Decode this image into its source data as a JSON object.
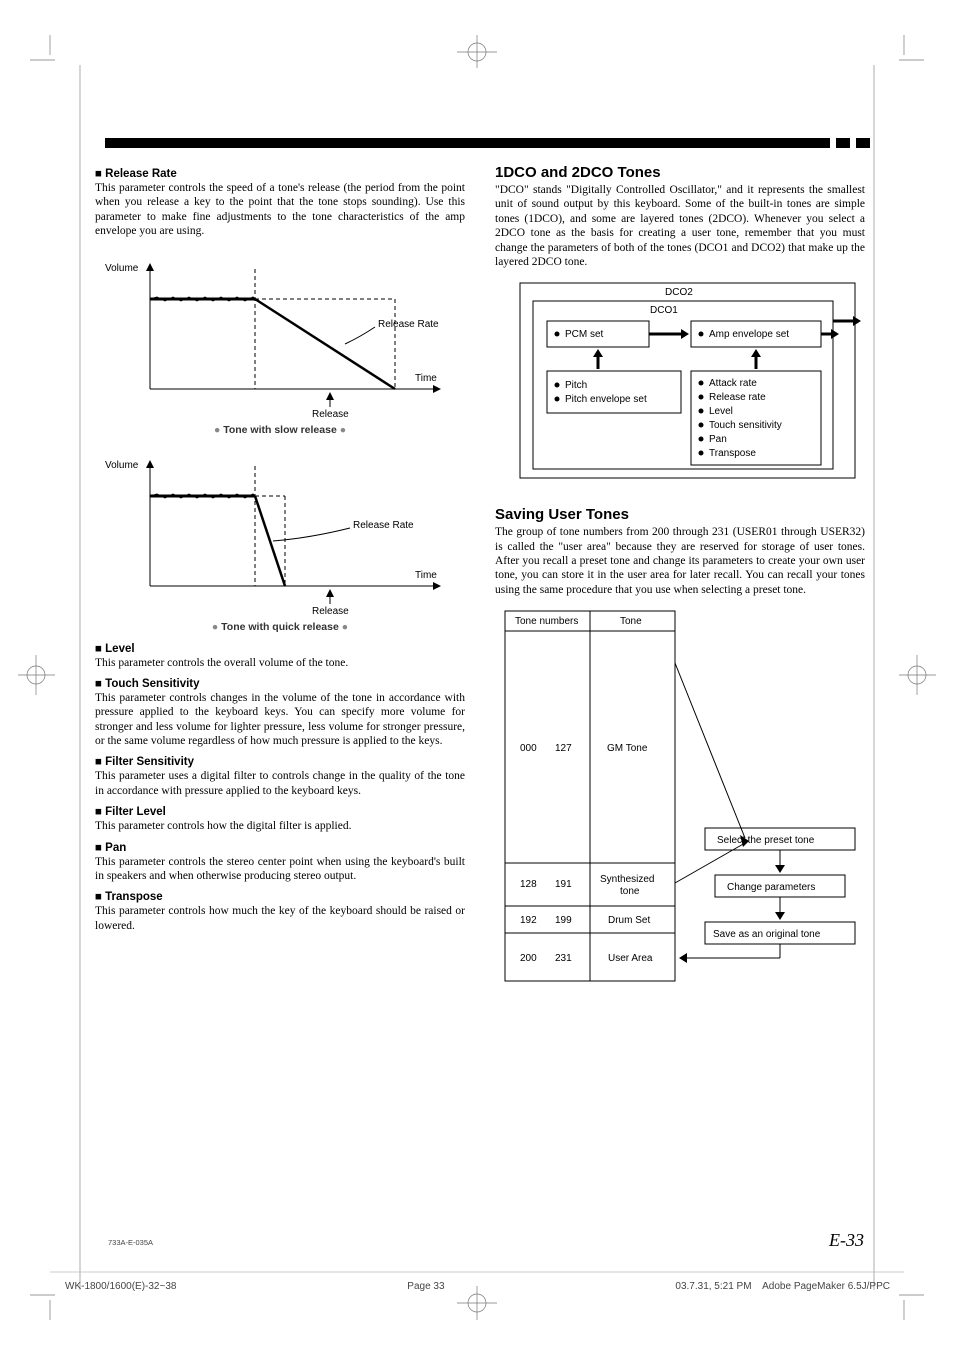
{
  "left": {
    "release_rate_h": "Release Rate",
    "release_rate_p": "This parameter controls the speed of a tone's release (the period from the point when you release a key to the point that the tone stops sounding). Use this parameter to make fine adjustments to the tone characteristics of the amp envelope you are using.",
    "graph1": {
      "ylabel": "Volume",
      "release_rate": "Release Rate",
      "release": "Release",
      "time": "Time",
      "caption": "Tone with slow release"
    },
    "graph2": {
      "ylabel": "Volume",
      "release_rate": "Release Rate",
      "release": "Release",
      "time": "Time",
      "caption": "Tone with quick release"
    },
    "level_h": "Level",
    "level_p": "This parameter controls the overall volume of the tone.",
    "touch_h": "Touch Sensitivity",
    "touch_p": "This parameter controls changes in the volume of the tone in accordance with pressure applied to the keyboard keys. You can specify more volume for stronger and less volume for lighter pressure, less volume for stronger pressure, or the same volume regardless of how much pressure is applied to the keys.",
    "filts_h": "Filter Sensitivity",
    "filts_p": "This parameter uses a digital filter to controls change in the quality of the tone in accordance with pressure applied to the keyboard keys.",
    "filtl_h": "Filter Level",
    "filtl_p": "This parameter controls how the digital filter is applied.",
    "pan_h": "Pan",
    "pan_p": "This parameter controls the stereo center point when using the keyboard's built in speakers and when otherwise producing stereo output.",
    "trans_h": "Transpose",
    "trans_p": "This parameter controls how much the key of the keyboard should be raised or lowered."
  },
  "right": {
    "dco_h": "1DCO and 2DCO Tones",
    "dco_p": "\"DCO\" stands \"Digitally Controlled Oscillator,\" and it represents the smallest unit of sound output by this keyboard. Some of the built-in tones are simple tones (1DCO), and some are layered tones (2DCO). Whenever you select a 2DCO tone as the basis for creating a user tone, remember that you must change the parameters of both of the tones (DCO1 and DCO2) that make up the layered 2DCO tone.",
    "dco_diagram": {
      "dco2": "DCO2",
      "dco1": "DCO1",
      "pcm": "PCM set",
      "amp": "Amp envelope set",
      "left_items": [
        "Pitch",
        "Pitch envelope set"
      ],
      "right_items": [
        "Attack rate",
        "Release rate",
        "Level",
        "Touch sensitivity",
        "Pan",
        "Transpose"
      ]
    },
    "save_h": "Saving User Tones",
    "save_p": "The group of tone numbers from 200 through 231 (USER01 through USER32) is called the \"user area\" because they are reserved for storage of user tones. After you recall a preset tone and change its parameters to create your own user tone, you can store it in the user area for later recall. You can recall your tones using the same procedure that you use when selecting a preset tone.",
    "tone_table": {
      "head_left": "Tone numbers",
      "head_right": "Tone",
      "rows": [
        {
          "range_a": "000",
          "range_b": "127",
          "label": "GM Tone"
        },
        {
          "range_a": "128",
          "range_b": "191",
          "label": "Synthesized tone"
        },
        {
          "range_a": "192",
          "range_b": "199",
          "label": "Drum Set"
        },
        {
          "range_a": "200",
          "range_b": "231",
          "label": "User Area"
        }
      ],
      "flow": [
        "Select the preset tone",
        "Change parameters",
        "Save as an original tone"
      ]
    }
  },
  "footer": {
    "code": "733A-E-035A",
    "page": "E-33",
    "strip_left": "WK-1800/1600(E)-32~38",
    "strip_page": "Page 33",
    "strip_date": "03.7.31, 5:21 PM",
    "strip_app": "Adobe PageMaker 6.5J/PPC"
  }
}
